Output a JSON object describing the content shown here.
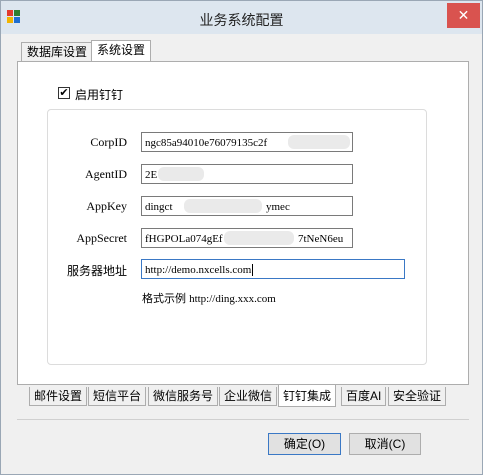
{
  "window": {
    "title": "业务系统配置",
    "close_symbol": "✕"
  },
  "top_tabs": [
    {
      "label": "数据库设置",
      "active": false
    },
    {
      "label": "系统设置",
      "active": true
    }
  ],
  "enable": {
    "label": "启用钉钉",
    "checked": true,
    "check_mark": "✔"
  },
  "fields": {
    "corp_id": {
      "label": "CorpID",
      "value": "ngc85a94010e76079135c2f"
    },
    "agent_id": {
      "label": "AgentID",
      "value": "2E"
    },
    "app_key": {
      "label": "AppKey",
      "value": "dingct",
      "tail": "ymec"
    },
    "app_secret": {
      "label": "AppSecret",
      "value": "fHGPOLa074gEf",
      "tail": "7tNeN6eu"
    },
    "server": {
      "label": "服务器地址",
      "value": "http://demo.nxcells.com"
    }
  },
  "hint": {
    "prefix": "格式示例",
    "example": "http://ding.xxx.com"
  },
  "bottom_tabs": [
    {
      "label": "邮件设置",
      "active": false
    },
    {
      "label": "短信平台",
      "active": false
    },
    {
      "label": "微信服务号",
      "active": false
    },
    {
      "label": "企业微信",
      "active": false
    },
    {
      "label": "钉钉集成",
      "active": true
    },
    {
      "label": "百度AI",
      "active": false
    },
    {
      "label": "安全验证",
      "active": false
    }
  ],
  "buttons": {
    "ok": "确定(O)",
    "cancel": "取消(C)"
  },
  "colors": {
    "close_button": "#d9534f",
    "focus_border": "#3a78c5",
    "titlebar": "#dde6ef"
  }
}
